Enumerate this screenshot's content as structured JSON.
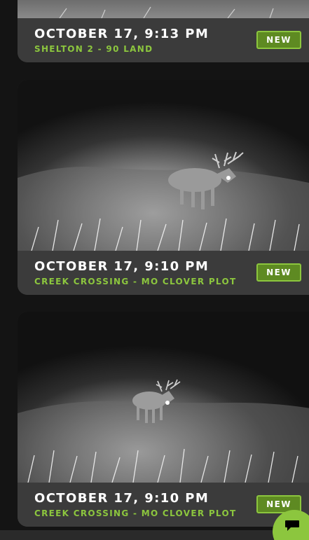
{
  "cards": [
    {
      "date": "OCTOBER 17, 9:13 PM",
      "location": "SHELTON 2 - 90 LAND",
      "badge": "NEW"
    },
    {
      "date": "OCTOBER 17, 9:10 PM",
      "location": "CREEK CROSSING - MO CLOVER PLOT",
      "badge": "NEW"
    },
    {
      "date": "OCTOBER 17, 9:10 PM",
      "location": "CREEK CROSSING - MO CLOVER PLOT",
      "badge": "NEW"
    }
  ],
  "fab": {
    "icon": "chat-bubble-icon"
  },
  "colors": {
    "accent": "#8cc63e",
    "badge_fill": "#5e8a22",
    "card_footer": "#3b3b3b",
    "background": "#141414"
  }
}
